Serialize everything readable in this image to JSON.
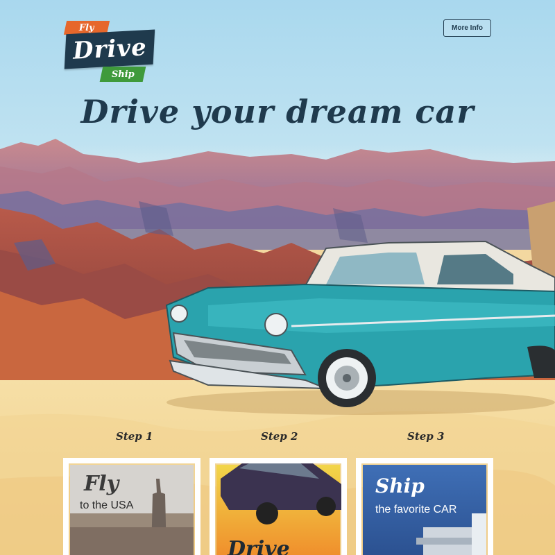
{
  "logo": {
    "fly": "Fly",
    "drive": "Drive",
    "ship": "Ship"
  },
  "header": {
    "more_info_label": "More Info"
  },
  "hero": {
    "headline": "Drive your dream car"
  },
  "steps": [
    {
      "label": "Step 1",
      "card_title": "Fly",
      "card_subtitle": "to the USA"
    },
    {
      "label": "Step 2",
      "card_title": "Drive",
      "card_subtitle": ""
    },
    {
      "label": "Step 3",
      "card_title": "Ship",
      "card_subtitle": "the favorite CAR"
    }
  ],
  "colors": {
    "navy": "#1f3a4d",
    "orange": "#e6672b",
    "green": "#3f9a3b",
    "car_teal": "#2aa3ad",
    "sand": "#f3d8a0"
  }
}
